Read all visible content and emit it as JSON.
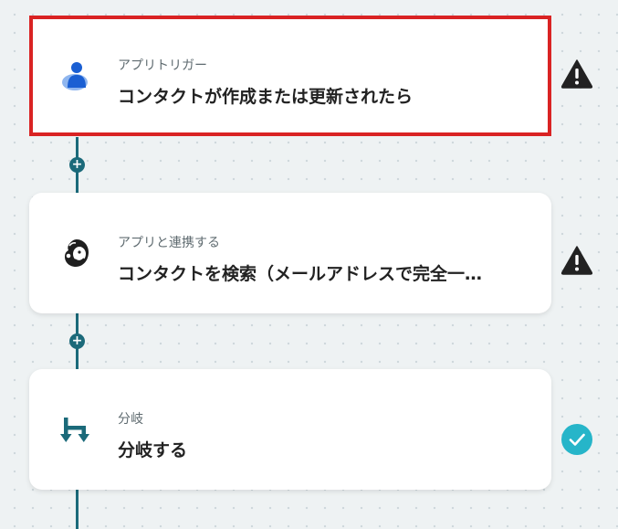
{
  "canvas": {
    "background": "#eef2f3",
    "accent_color": "#1b6a7a",
    "selected_border_color": "#d92323"
  },
  "nodes": [
    {
      "subtitle": "アプリトリガー",
      "title": "コンタクトが作成または更新されたら",
      "icon": "person-icon",
      "status": "warning-icon",
      "selected": true
    },
    {
      "subtitle": "アプリと連携する",
      "title": "コンタクトを検索（メールアドレスで完全一…",
      "icon": "mailchimp-icon",
      "status": "warning-icon",
      "selected": false
    },
    {
      "subtitle": "分岐",
      "title": "分岐する",
      "icon": "branch-icon",
      "status": "check-icon",
      "selected": false
    }
  ],
  "add_step_label": "+",
  "status_colors": {
    "warning": "#222222",
    "check": "#26b5c9"
  }
}
